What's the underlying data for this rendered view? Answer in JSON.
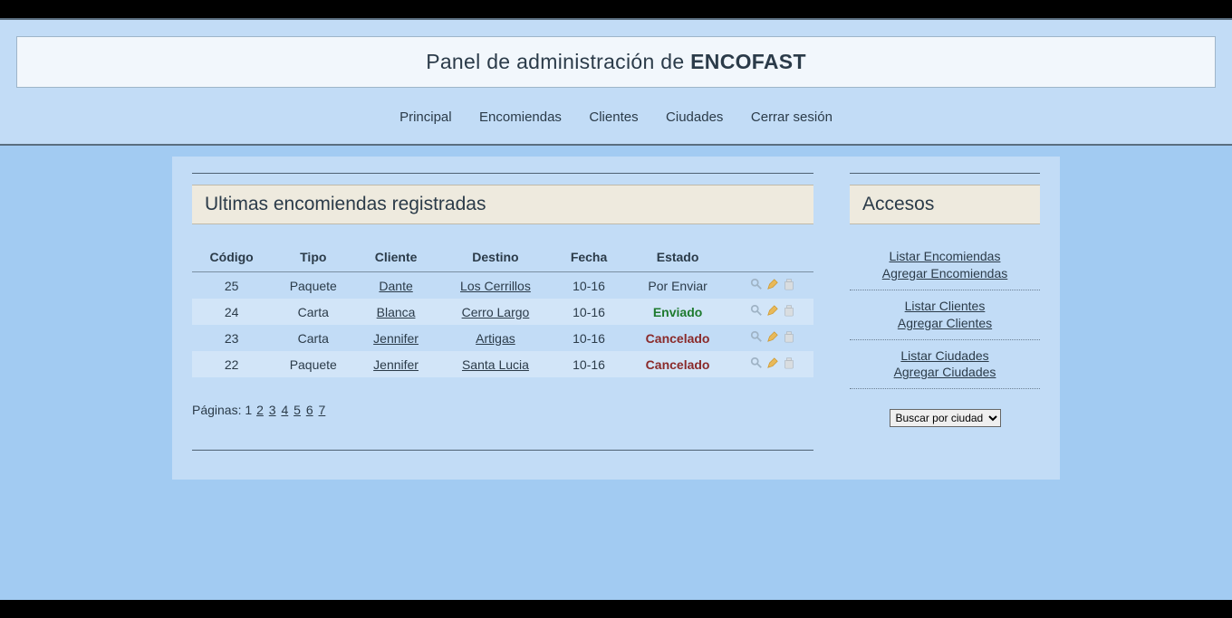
{
  "header": {
    "title_prefix": "Panel de administración de ",
    "brand": "ENCOFAST"
  },
  "nav": [
    "Principal",
    "Encomiendas",
    "Clientes",
    "Ciudades",
    "Cerrar sesión"
  ],
  "main": {
    "title": "Ultimas encomiendas registradas",
    "columns": [
      "Código",
      "Tipo",
      "Cliente",
      "Destino",
      "Fecha",
      "Estado"
    ],
    "rows": [
      {
        "codigo": "25",
        "tipo": "Paquete",
        "cliente": "Dante",
        "destino": "Los Cerrillos",
        "fecha": "10-16",
        "estado": "Por Enviar",
        "estado_kind": "porenviar"
      },
      {
        "codigo": "24",
        "tipo": "Carta",
        "cliente": "Blanca",
        "destino": "Cerro Largo",
        "fecha": "10-16",
        "estado": "Enviado",
        "estado_kind": "enviado"
      },
      {
        "codigo": "23",
        "tipo": "Carta",
        "cliente": "Jennifer",
        "destino": "Artigas",
        "fecha": "10-16",
        "estado": "Cancelado",
        "estado_kind": "cancelado"
      },
      {
        "codigo": "22",
        "tipo": "Paquete",
        "cliente": "Jennifer",
        "destino": "Santa Lucia",
        "fecha": "10-16",
        "estado": "Cancelado",
        "estado_kind": "cancelado"
      }
    ],
    "paginate_label": "Páginas: ",
    "current_page": "1",
    "pages": [
      "2",
      "3",
      "4",
      "5",
      "6",
      "7"
    ]
  },
  "sidebar": {
    "title": "Accesos",
    "groups": [
      [
        "Listar Encomiendas",
        "Agregar Encomiendas"
      ],
      [
        "Listar Clientes",
        "Agregar Clientes"
      ],
      [
        "Listar Ciudades",
        "Agregar Ciudades"
      ]
    ],
    "search_selected": "Buscar por ciudad"
  }
}
